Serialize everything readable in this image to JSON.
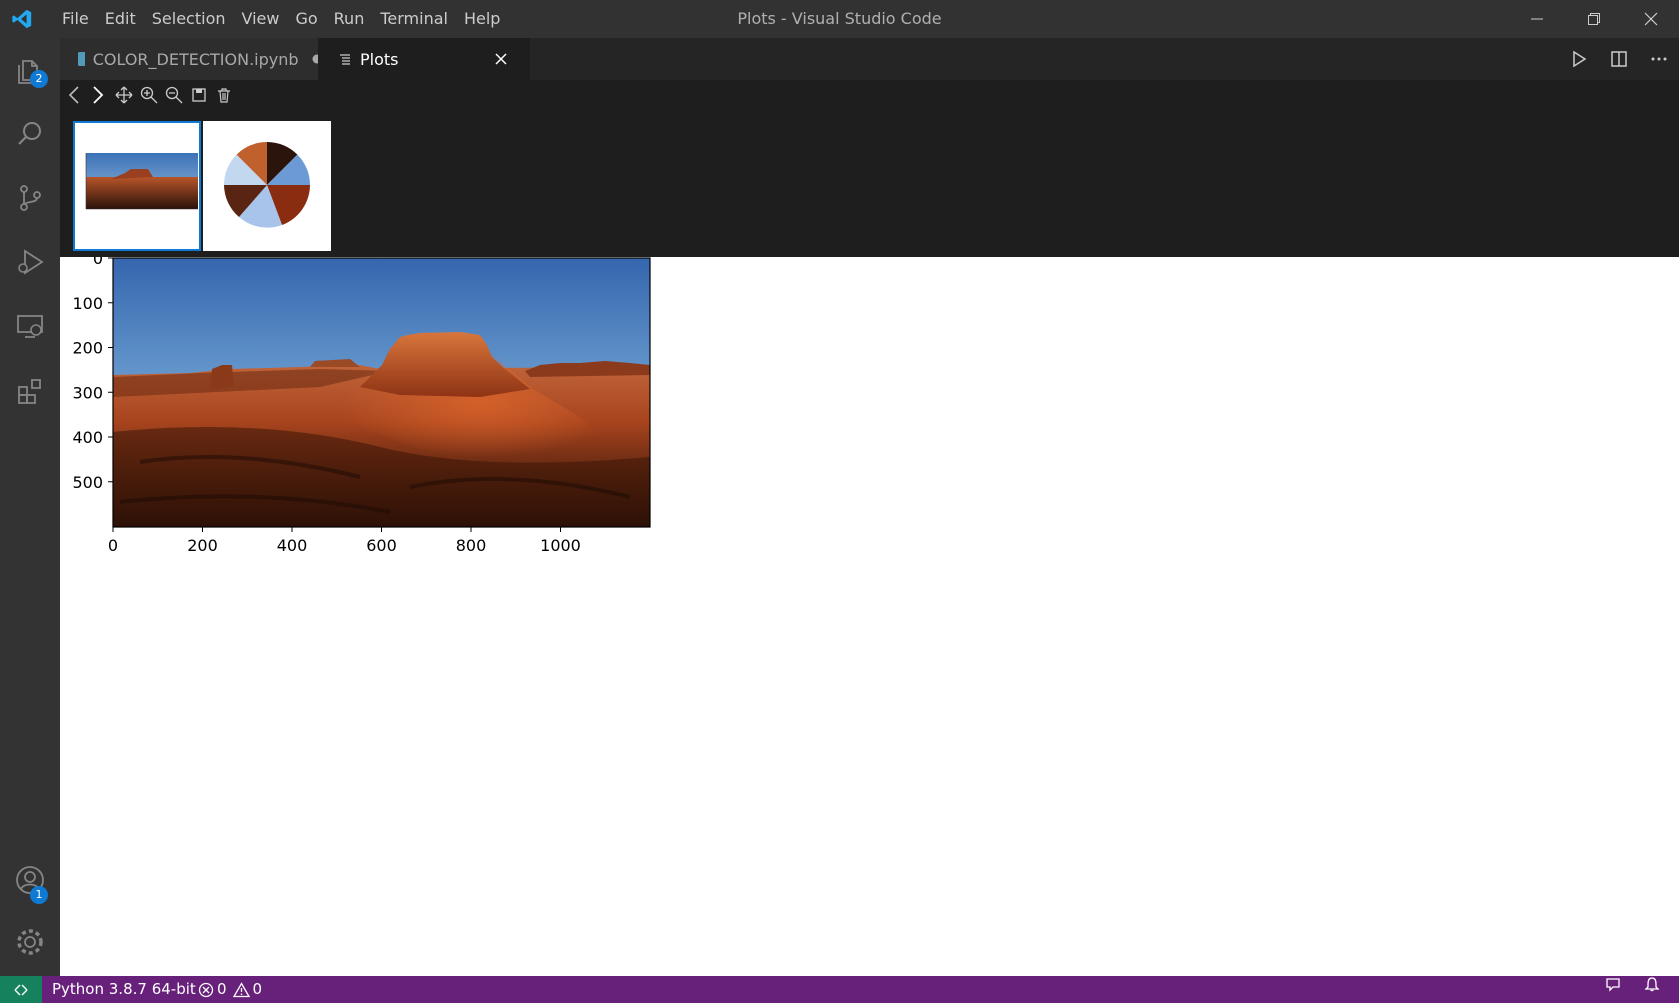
{
  "window": {
    "title": "Plots - Visual Studio Code",
    "menu": [
      "File",
      "Edit",
      "Selection",
      "View",
      "Go",
      "Run",
      "Terminal",
      "Help"
    ]
  },
  "activity_bar": {
    "explorer_badge": "2",
    "accounts_badge": "1"
  },
  "tabs": [
    {
      "label": "COLOR_DETECTION.ipynb",
      "modified": true
    },
    {
      "label": "Plots",
      "active": true
    }
  ],
  "plot": {
    "x_ticks": [
      "0",
      "200",
      "400",
      "600",
      "800",
      "1000"
    ],
    "y_ticks": [
      "0",
      "100",
      "200",
      "300",
      "400",
      "500"
    ]
  },
  "thumbnails": [
    {
      "kind": "image-plot",
      "selected": true
    },
    {
      "kind": "pie-chart",
      "selected": false
    }
  ],
  "status": {
    "python": "Python 3.8.7 64-bit",
    "errors": "0",
    "warnings": "0"
  },
  "colors": {
    "accent": "#0e7ad3",
    "status_bar": "#68217a",
    "remote": "#16825d"
  }
}
